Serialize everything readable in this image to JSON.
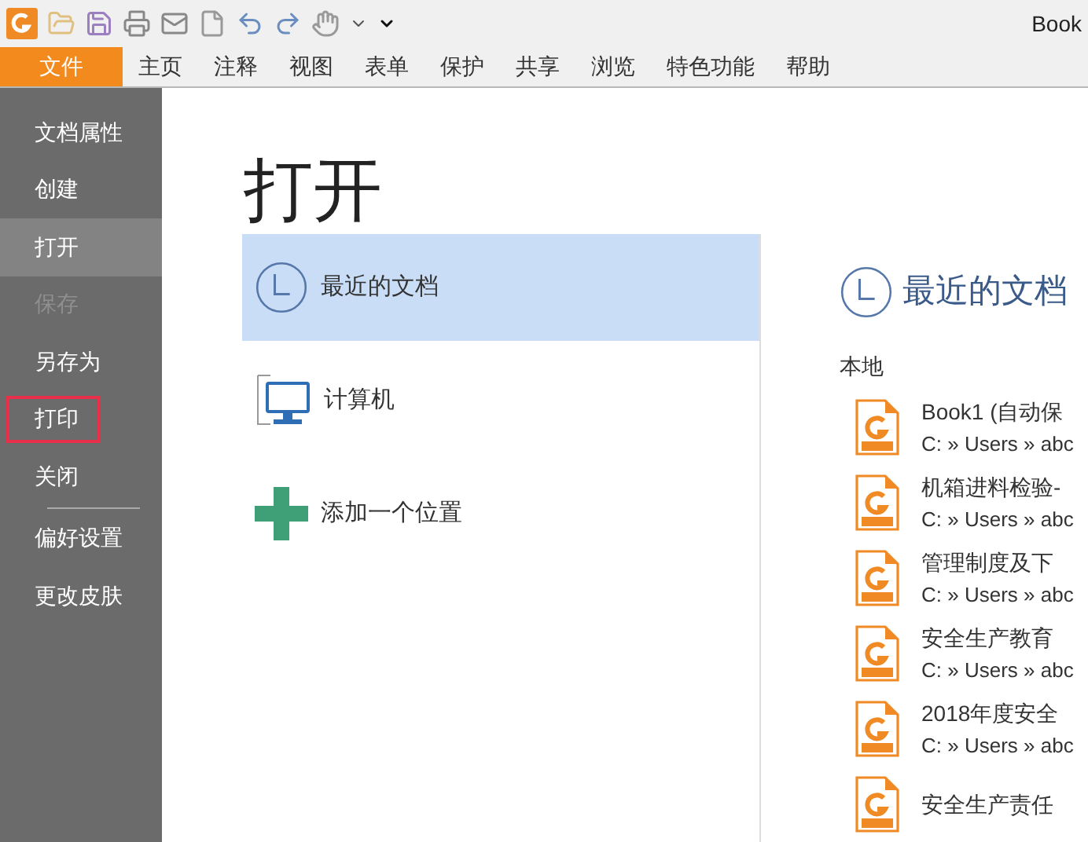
{
  "window": {
    "title": "Book"
  },
  "ribbon_tabs": [
    {
      "label": "文件",
      "selected": true
    },
    {
      "label": "主页",
      "selected": false
    },
    {
      "label": "注释",
      "selected": false
    },
    {
      "label": "视图",
      "selected": false
    },
    {
      "label": "表单",
      "selected": false
    },
    {
      "label": "保护",
      "selected": false
    },
    {
      "label": "共享",
      "selected": false
    },
    {
      "label": "浏览",
      "selected": false
    },
    {
      "label": "特色功能",
      "selected": false
    },
    {
      "label": "帮助",
      "selected": false
    }
  ],
  "sidebar": {
    "groups": [
      {
        "items": [
          {
            "label": "文档属性",
            "selected": false,
            "disabled": false,
            "outlined": false
          },
          {
            "label": "创建",
            "selected": false,
            "disabled": false,
            "outlined": false
          },
          {
            "label": "打开",
            "selected": true,
            "disabled": false,
            "outlined": false
          },
          {
            "label": "保存",
            "selected": false,
            "disabled": true,
            "outlined": false
          },
          {
            "label": "另存为",
            "selected": false,
            "disabled": false,
            "outlined": false
          },
          {
            "label": "打印",
            "selected": false,
            "disabled": false,
            "outlined": true
          },
          {
            "label": "关闭",
            "selected": false,
            "disabled": false,
            "outlined": false
          }
        ]
      },
      {
        "items": [
          {
            "label": "偏好设置",
            "selected": false,
            "disabled": false,
            "outlined": false
          },
          {
            "label": "更改皮肤",
            "selected": false,
            "disabled": false,
            "outlined": false
          }
        ]
      }
    ]
  },
  "page_title": "打开",
  "places": [
    {
      "kind": "recent",
      "label": "最近的文档",
      "selected": true
    },
    {
      "kind": "computer",
      "label": "计算机",
      "selected": false
    },
    {
      "kind": "add",
      "label": "添加一个位置",
      "selected": false
    }
  ],
  "recent": {
    "title": "最近的文档",
    "section": "本地",
    "files": [
      {
        "name": "Book1 (自动保",
        "path": "C: » Users » abc"
      },
      {
        "name": "机箱进料检验-",
        "path": "C: » Users » abc"
      },
      {
        "name": "管理制度及下",
        "path": "C: » Users » abc"
      },
      {
        "name": "安全生产教育",
        "path": "C: » Users » abc"
      },
      {
        "name": "2018年度安全",
        "path": "C: » Users » abc"
      },
      {
        "name": "安全生产责任"
      }
    ]
  }
}
